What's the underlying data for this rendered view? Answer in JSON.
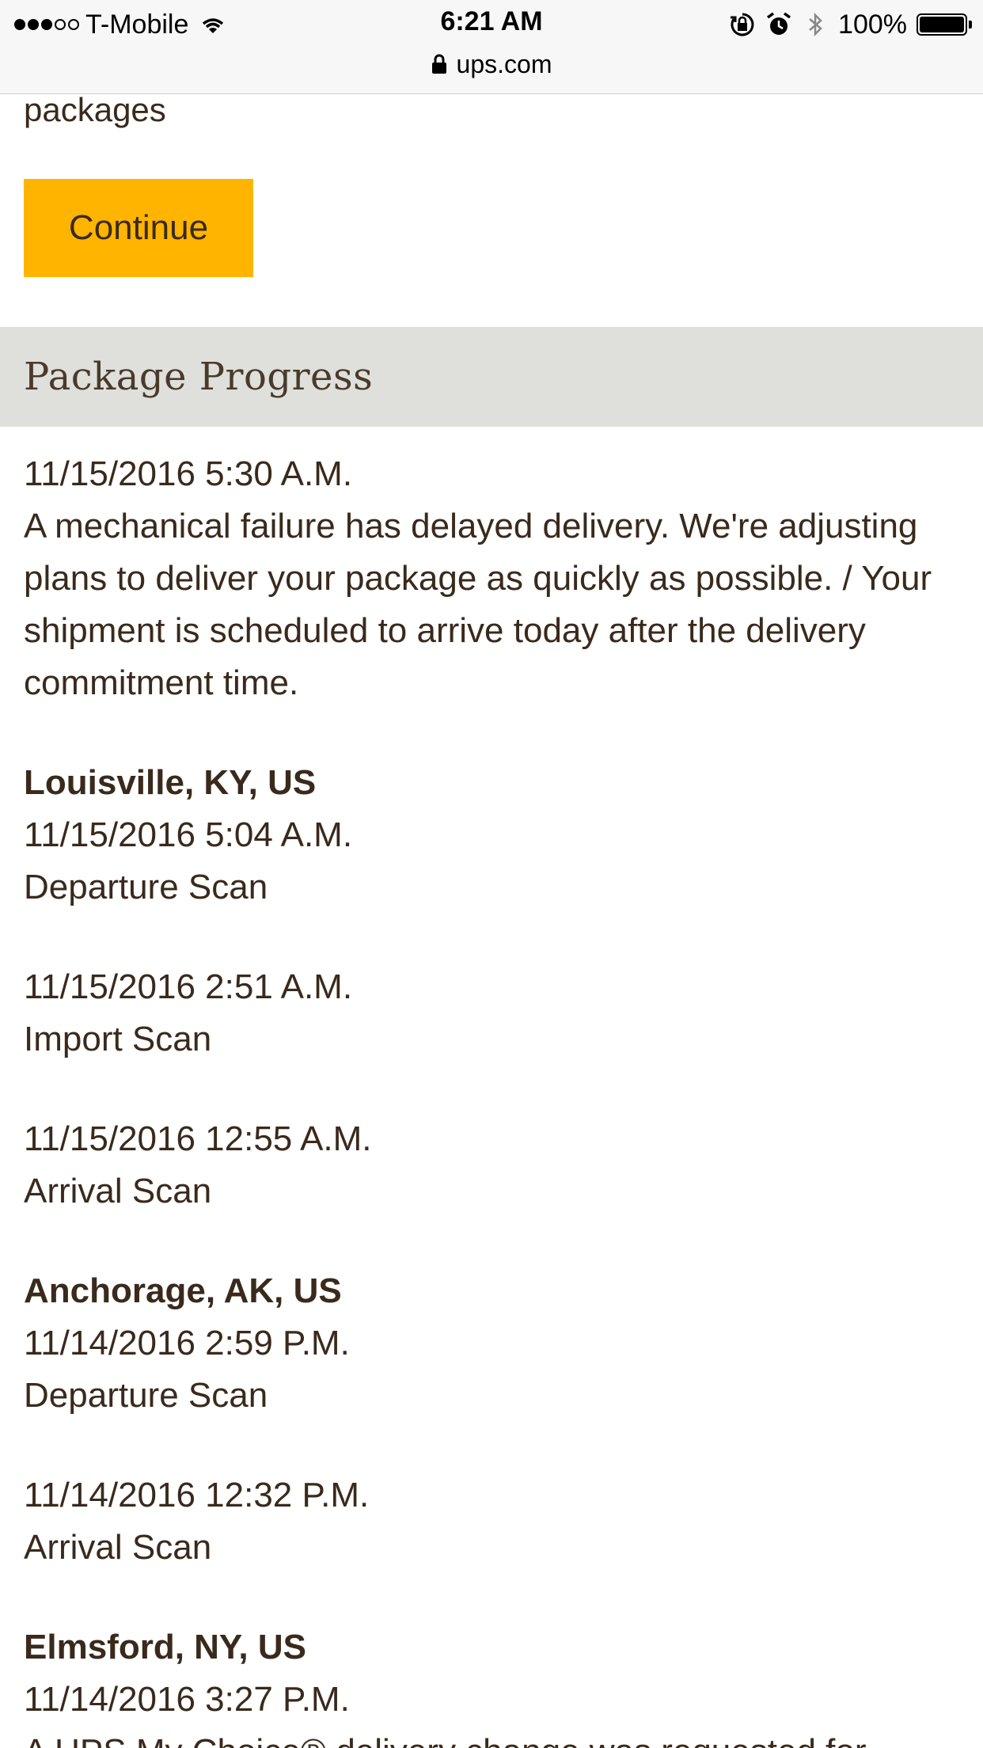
{
  "status_bar": {
    "carrier": "T-Mobile",
    "time": "6:21 AM",
    "battery": "100%",
    "url": "ups.com"
  },
  "page": {
    "fragment_text": "packages",
    "continue_label": "Continue",
    "section_title": "Package Progress"
  },
  "events": [
    {
      "datetime": "11/15/2016 5:30 A.M.",
      "description": "A mechanical failure has delayed delivery. We're adjusting plans to deliver your package as quickly as possible. / Your shipment is scheduled to arrive today after the delivery commitment time."
    },
    {
      "location": "Louisville, KY, US",
      "datetime": "11/15/2016 5:04 A.M.",
      "description": "Departure Scan"
    },
    {
      "datetime": "11/15/2016 2:51 A.M.",
      "description": "Import Scan"
    },
    {
      "datetime": "11/15/2016 12:55 A.M.",
      "description": "Arrival Scan"
    },
    {
      "location": "Anchorage, AK, US",
      "datetime": "11/14/2016 2:59 P.M.",
      "description": "Departure Scan"
    },
    {
      "datetime": "11/14/2016 12:32 P.M.",
      "description": "Arrival Scan"
    },
    {
      "location": "Elmsford, NY, US",
      "datetime": "11/14/2016 3:27 P.M.",
      "description": "A UPS My Choice® delivery change was requested for"
    }
  ]
}
